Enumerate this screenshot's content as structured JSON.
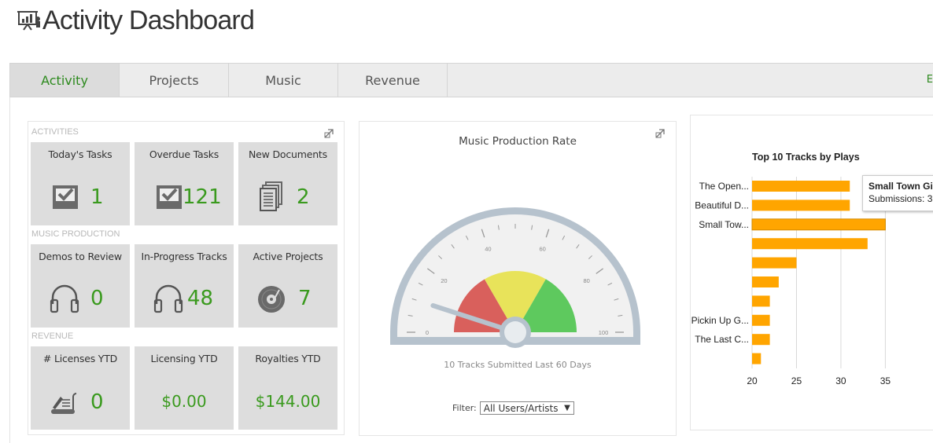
{
  "header": {
    "title": "Activity Dashboard",
    "icon": "presentation-chart-icon"
  },
  "tabs": [
    {
      "label": "Activity",
      "active": true
    },
    {
      "label": "Projects",
      "active": false
    },
    {
      "label": "Music",
      "active": false
    },
    {
      "label": "Revenue",
      "active": false
    }
  ],
  "tab_extra": "E",
  "colors": {
    "accent": "#2d8a1e",
    "tile_bg": "#dddddd",
    "bar": "#ffa500",
    "gauge_red": "#d9605c",
    "gauge_yellow": "#e8e35a",
    "gauge_green": "#5ec95e"
  },
  "sections": {
    "activities": "ACTIVITIES",
    "music_production": "MUSIC PRODUCTION",
    "revenue": "REVENUE"
  },
  "tiles": [
    {
      "label": "Today's Tasks",
      "value": "1",
      "icon": "task-check-icon"
    },
    {
      "label": "Overdue Tasks",
      "value": "121",
      "icon": "task-check-icon"
    },
    {
      "label": "New Documents",
      "value": "2",
      "icon": "documents-icon"
    },
    {
      "label": "Demos to Review",
      "value": "0",
      "icon": "headphones-icon"
    },
    {
      "label": "In-Progress Tracks",
      "value": "48",
      "icon": "headphones-icon"
    },
    {
      "label": "Active Projects",
      "value": "7",
      "icon": "vinyl-record-icon"
    },
    {
      "label": "# Licenses YTD",
      "value": "0",
      "icon": "contract-scroll-icon"
    },
    {
      "label": "Licensing YTD",
      "value": "$0.00",
      "icon": ""
    },
    {
      "label": "Royalties YTD",
      "value": "$144.00",
      "icon": ""
    }
  ],
  "gauge": {
    "title": "Music Production Rate",
    "subtitle": "10 Tracks Submitted Last 60 Days",
    "value": 10,
    "min": 0,
    "max": 100,
    "major_tick_labels": [
      "0",
      "20",
      "40",
      "60",
      "80",
      "100"
    ],
    "bands": [
      {
        "from": 0,
        "to": 33.3,
        "color": "red"
      },
      {
        "from": 33.3,
        "to": 66.6,
        "color": "yellow"
      },
      {
        "from": 66.6,
        "to": 100,
        "color": "green"
      }
    ],
    "filter_label": "Filter:",
    "filter_value": "All Users/Artists"
  },
  "chart_data": {
    "type": "bar",
    "orientation": "horizontal",
    "title": "Top 10 Tracks by Plays",
    "categories": [
      "The Open...",
      "Beautiful D...",
      "Small Tow...",
      "",
      "",
      "",
      "",
      "Pickin Up G...",
      "The Last C...",
      ""
    ],
    "values": [
      31,
      31,
      35,
      33,
      25,
      23,
      22,
      22,
      22,
      21
    ],
    "xlim": [
      20,
      37
    ],
    "xticks": [
      "20",
      "25",
      "30",
      "35"
    ],
    "grid": true,
    "tooltip": {
      "title": "Small Town Gi",
      "label": "Submissions:",
      "value": "3"
    }
  }
}
